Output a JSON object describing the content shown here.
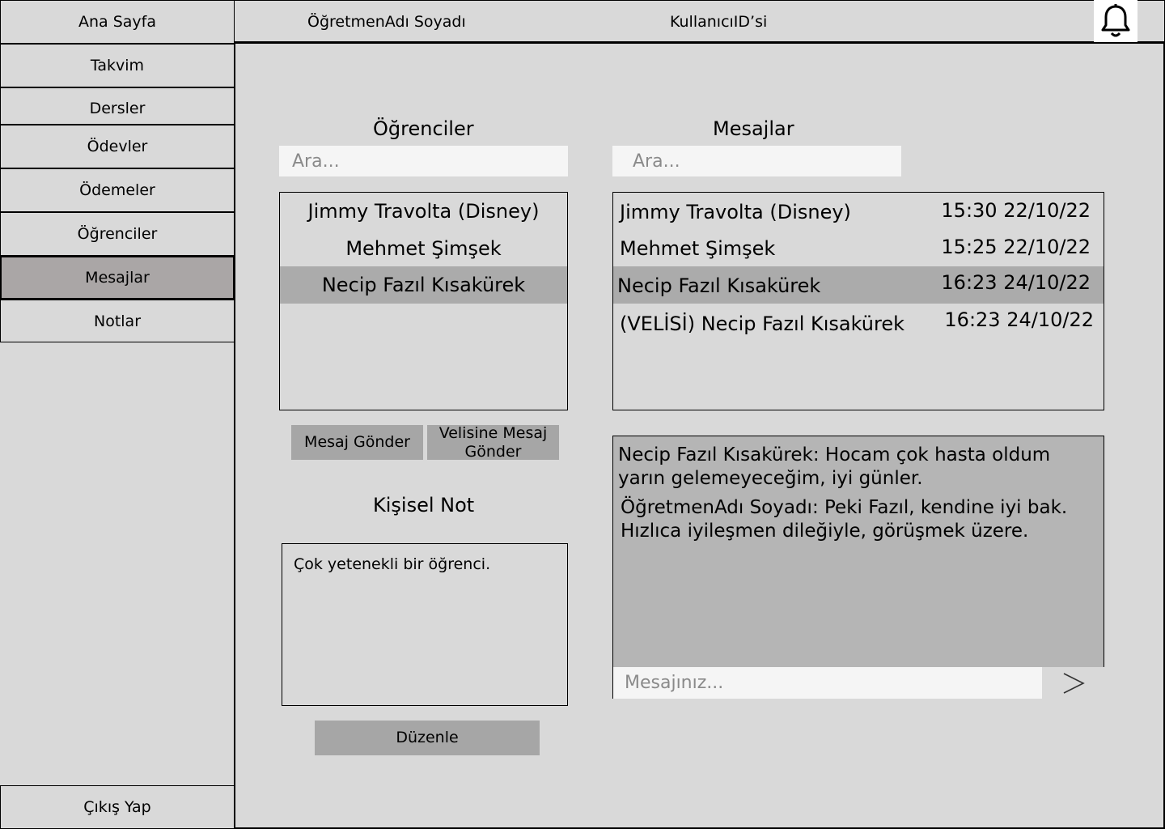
{
  "sidebar": {
    "home": "Ana Sayfa",
    "items": [
      {
        "label": "Takvim"
      },
      {
        "label": "Dersler"
      },
      {
        "label": "Ödevler"
      },
      {
        "label": "Ödemeler"
      },
      {
        "label": "Öğrenciler"
      },
      {
        "label": "Mesajlar",
        "active": true
      },
      {
        "label": "Notlar"
      }
    ],
    "logout": "Çıkış Yap"
  },
  "header": {
    "teacher_name": "ÖğretmenAdı Soyadı",
    "user_id": "KullanıcıID’si",
    "notification_icon": "bell-icon"
  },
  "students": {
    "title": "Öğrenciler",
    "search_placeholder": "Ara...",
    "list": [
      {
        "name": "Jimmy Travolta (Disney)"
      },
      {
        "name": "Mehmet Şimşek"
      },
      {
        "name": "Necip Fazıl Kısakürek",
        "selected": true
      }
    ],
    "send_message": "Mesaj Gönder",
    "send_parent_message": "Velisine Mesaj Gönder"
  },
  "note": {
    "title": "Kişisel Not",
    "text": "Çok yetenekli bir öğrenci.",
    "edit": "Düzenle"
  },
  "messages": {
    "title": "Mesajlar",
    "search_placeholder": "Ara...",
    "list": [
      {
        "name": "Jimmy Travolta (Disney)",
        "time": "15:30 22/10/22"
      },
      {
        "name": "Mehmet Şimşek",
        "time": "15:25 22/10/22"
      },
      {
        "name": "Necip Fazıl Kısakürek",
        "time": "16:23 24/10/22",
        "selected": true
      },
      {
        "name": "(VELİSİ) Necip Fazıl Kısakürek",
        "time": "16:23 24/10/22"
      }
    ],
    "chat": [
      {
        "line1": "Necip Fazıl Kısakürek: Hocam çok hasta oldum",
        "line2": "yarın gelemeyeceğim, iyi günler."
      },
      {
        "line1": "ÖğretmenAdı Soyadı: Peki Fazıl, kendine iyi bak.",
        "line2": "Hızlıca iyileşmen dileğiyle, görüşmek üzere."
      }
    ],
    "input_placeholder": "Mesajınız...",
    "send_icon": "send-arrow-icon"
  },
  "colors": {
    "background": "#d9d9d9",
    "active_nav": "#aaa6a6",
    "selected_row": "#ababab",
    "button": "#a6a6a6",
    "chat_bg": "#b5b5b5"
  }
}
